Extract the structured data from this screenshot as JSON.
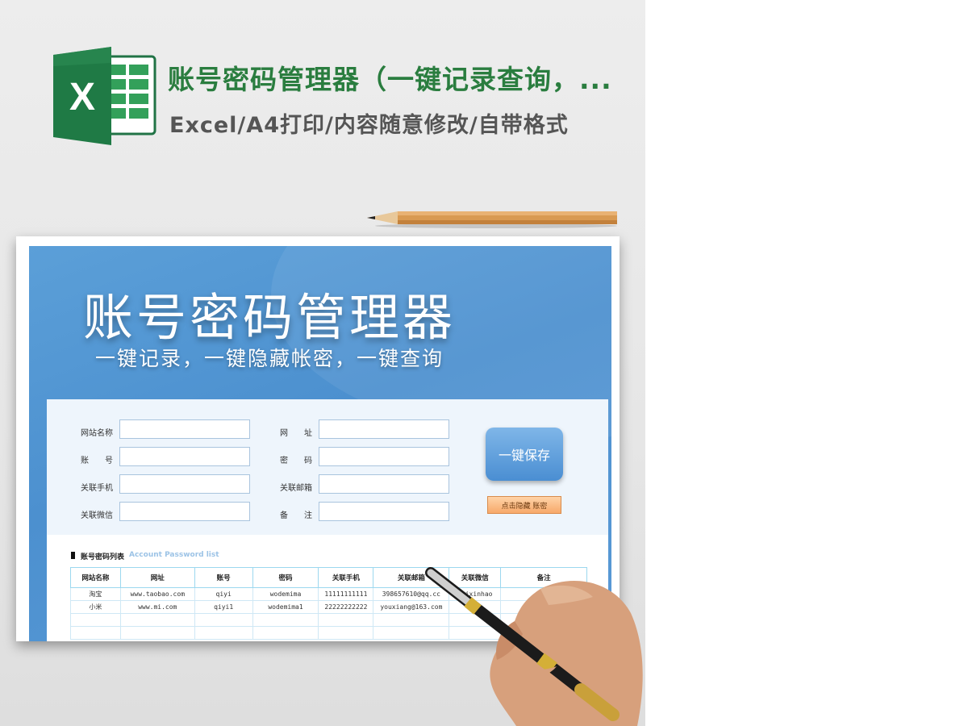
{
  "header": {
    "logo_letter": "X",
    "title": "账号密码管理器（一键记录查询，...",
    "subtitle": "Excel/A4打印/内容随意修改/自带格式"
  },
  "app": {
    "title": "账号密码管理器",
    "subtitle": "一键记录，一键隐藏帐密，一键查询"
  },
  "form": {
    "fields": [
      {
        "label": "网站名称",
        "value": ""
      },
      {
        "label": "网　　址",
        "value": ""
      },
      {
        "label": "账　　号",
        "value": ""
      },
      {
        "label": "密　　码",
        "value": ""
      },
      {
        "label": "关联手机",
        "value": ""
      },
      {
        "label": "关联邮箱",
        "value": ""
      },
      {
        "label": "关联微信",
        "value": ""
      },
      {
        "label": "备　　注",
        "value": ""
      }
    ],
    "save_button": "一键保存",
    "hide_button": "点击隐藏 账密"
  },
  "list": {
    "title": "账号密码列表",
    "subtitle": "Account Password list",
    "columns": [
      "网站名称",
      "网址",
      "账号",
      "密码",
      "关联手机",
      "关联邮箱",
      "关联微信",
      "备注"
    ],
    "rows": [
      [
        "淘宝",
        "www.taobao.com",
        "qiyi",
        "wodemima",
        "11111111111",
        "398657610@qq.cc",
        "weixinhao",
        ""
      ],
      [
        "小米",
        "www.mi.com",
        "qiyi1",
        "wodemima1",
        "22222222222",
        "youxiang@163.com",
        "",
        ""
      ],
      [
        "",
        "",
        "",
        "",
        "",
        "",
        "",
        ""
      ],
      [
        "",
        "",
        "",
        "",
        "",
        "",
        "",
        ""
      ]
    ]
  },
  "colors": {
    "excel_green": "#217346",
    "headline_green": "#2a7d3f",
    "banner_blue": "#4c90cf",
    "save_button_blue": "#4a8ed2",
    "hide_button_orange": "#f7a96a"
  },
  "icons": {
    "logo": "excel-logo-icon",
    "pencil": "pencil-icon",
    "hand": "hand-with-pen-icon"
  }
}
